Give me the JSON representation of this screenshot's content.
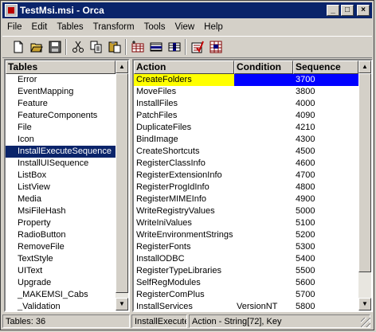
{
  "window": {
    "title": "TestMsi.msi - Orca"
  },
  "caption_buttons": {
    "minimize": "_",
    "maximize": "□",
    "close": "×"
  },
  "menu": [
    "File",
    "Edit",
    "Tables",
    "Transform",
    "Tools",
    "View",
    "Help"
  ],
  "toolbar": [
    "new-icon",
    "open-icon",
    "save-icon",
    "cut-icon",
    "copy-icon",
    "paste-icon",
    "table-add-icon",
    "row-add-icon",
    "column-icon",
    "validate-icon",
    "merge-icon"
  ],
  "tables_pane": {
    "header": "Tables",
    "items": [
      "Error",
      "EventMapping",
      "Feature",
      "FeatureComponents",
      "File",
      "Icon",
      "InstallExecuteSequence",
      "InstallUISequence",
      "ListBox",
      "ListView",
      "Media",
      "MsiFileHash",
      "Property",
      "RadioButton",
      "RemoveFile",
      "TextStyle",
      "UIText",
      "Upgrade",
      "_MAKEMSI_Cabs",
      "_Validation"
    ],
    "selected": "InstallExecuteSequence"
  },
  "grid": {
    "columns": [
      "Action",
      "Condition",
      "Sequence"
    ],
    "rows": [
      [
        "CreateFolders",
        "",
        "3700"
      ],
      [
        "MoveFiles",
        "",
        "3800"
      ],
      [
        "InstallFiles",
        "",
        "4000"
      ],
      [
        "PatchFiles",
        "",
        "4090"
      ],
      [
        "DuplicateFiles",
        "",
        "4210"
      ],
      [
        "BindImage",
        "",
        "4300"
      ],
      [
        "CreateShortcuts",
        "",
        "4500"
      ],
      [
        "RegisterClassInfo",
        "",
        "4600"
      ],
      [
        "RegisterExtensionInfo",
        "",
        "4700"
      ],
      [
        "RegisterProgIdInfo",
        "",
        "4800"
      ],
      [
        "RegisterMIMEInfo",
        "",
        "4900"
      ],
      [
        "WriteRegistryValues",
        "",
        "5000"
      ],
      [
        "WriteIniValues",
        "",
        "5100"
      ],
      [
        "WriteEnvironmentStrings",
        "",
        "5200"
      ],
      [
        "RegisterFonts",
        "",
        "5300"
      ],
      [
        "InstallODBC",
        "",
        "5400"
      ],
      [
        "RegisterTypeLibraries",
        "",
        "5500"
      ],
      [
        "SelfRegModules",
        "",
        "5600"
      ],
      [
        "RegisterComPlus",
        "",
        "5700"
      ],
      [
        "InstallServices",
        "VersionNT",
        "5800"
      ]
    ],
    "selected_row": 0,
    "colors": {
      "selected_action_bg": "#ffff00",
      "selected_bg": "#0000ff"
    }
  },
  "statusbar": {
    "tables": "Tables: 36",
    "table": "InstallExecute",
    "column": "Action - String[72], Key"
  }
}
